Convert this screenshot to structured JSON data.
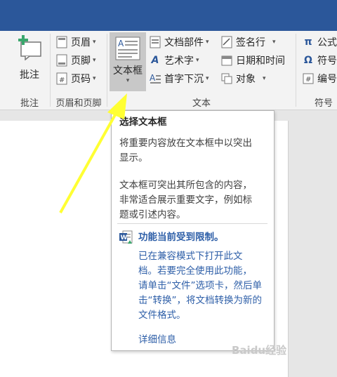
{
  "ribbon": {
    "comment": {
      "label": "批注",
      "group": "批注"
    },
    "header_footer": {
      "group": "页眉和页脚",
      "header": "页眉",
      "footer": "页脚",
      "page_number": "页码"
    },
    "text": {
      "group": "文本",
      "textbox": "文本框",
      "quick_parts": "文档部件",
      "wordart": "艺术字",
      "drop_cap": "首字下沉",
      "signature_line": "签名行",
      "date_time": "日期和时间",
      "object": "对象"
    },
    "symbols": {
      "group": "符号",
      "equation": "公式",
      "symbol": "符号",
      "number": "编号"
    }
  },
  "tooltip": {
    "title": "选择文本框",
    "para1": "将重要内容放在文本框中以突出\n显示。",
    "para2": "文本框可突出其所包含的内容，\n非常适合展示重要文字，例如标\n题或引述内容。",
    "warning_title": "功能当前受到限制。",
    "warning_text": "已在兼容模式下打开此文\n档。若要完全使用此功能，\n请单击“文件”选项卡，然后单\n击“转换”，将文档转换为新的\n文件格式。",
    "more_info": "详细信息"
  },
  "watermark": "Baidu经验",
  "colors": {
    "titlebar": "#2b579a",
    "link": "#2e5fa8",
    "arrow": "#ffff33"
  }
}
